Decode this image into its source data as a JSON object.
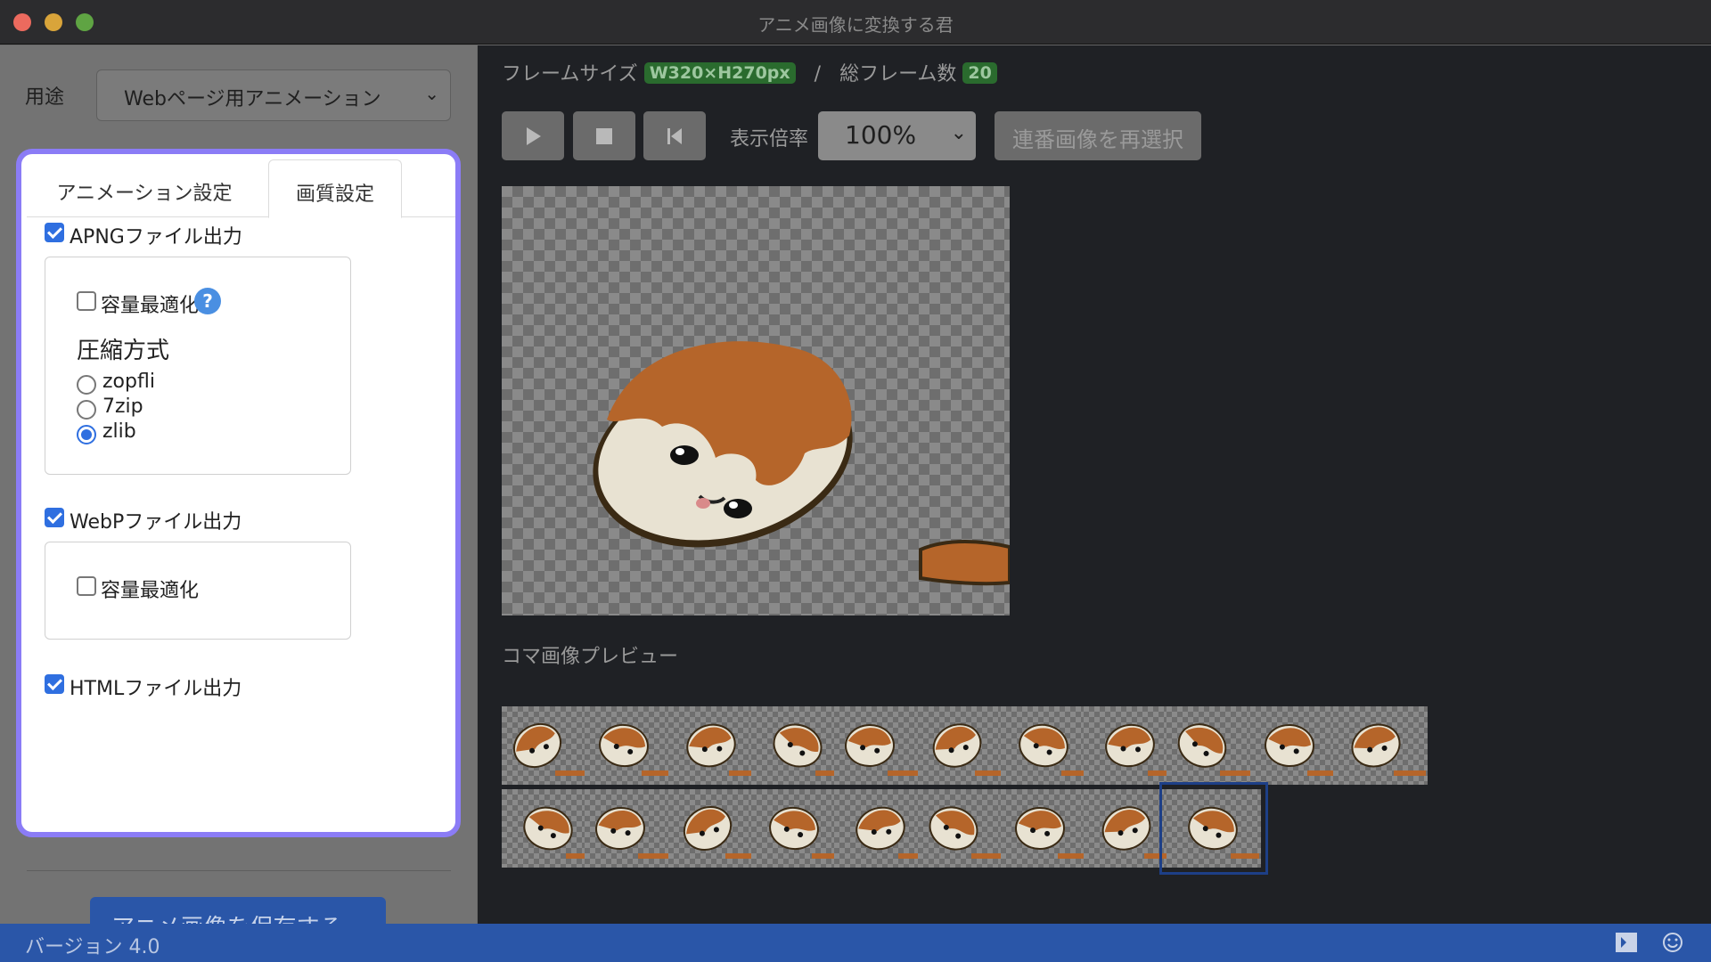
{
  "window": {
    "title": "アニメ画像に変換する君"
  },
  "usage": {
    "label": "用途",
    "selected": "Webページ用アニメーション"
  },
  "tabs": [
    {
      "label": "アニメーション設定",
      "active": false
    },
    {
      "label": "画質設定",
      "active": true
    }
  ],
  "apng": {
    "label": "APNGファイル出力",
    "checked": true,
    "optimize_label": "容量最適化",
    "optimize_checked": false,
    "help": "?",
    "compression_heading": "圧縮方式",
    "methods": [
      {
        "label": "zopfli",
        "selected": false
      },
      {
        "label": "7zip",
        "selected": false
      },
      {
        "label": "zlib",
        "selected": true
      }
    ]
  },
  "webp": {
    "label": "WebPファイル出力",
    "checked": true,
    "optimize_label": "容量最適化",
    "optimize_checked": false
  },
  "html": {
    "label": "HTMLファイル出力",
    "checked": true
  },
  "save_button": "アニメ画像を保存する",
  "info": {
    "frame_size_label": "フレームサイズ",
    "frame_size": "W320×H270px",
    "separator": "/",
    "total_frames_label": "総フレーム数",
    "total_frames": "20"
  },
  "controls": {
    "zoom_label": "表示倍率",
    "zoom": "100%",
    "reselect": "連番画像を再選択",
    "play_icon": "play-icon",
    "stop_icon": "stop-icon",
    "rewind_icon": "skip-back-icon"
  },
  "frames": {
    "label": "コマ画像プレビュー",
    "count": 20,
    "selected_index": 19
  },
  "status": {
    "version": "バージョン 4.0",
    "icon1": "shortcut-icon",
    "icon2": "smile-icon"
  },
  "colors": {
    "accent": "#2a56a8",
    "card_border": "#8b7cf6",
    "checkbox": "#2f6fe0",
    "pill": "#2a6b2e"
  }
}
